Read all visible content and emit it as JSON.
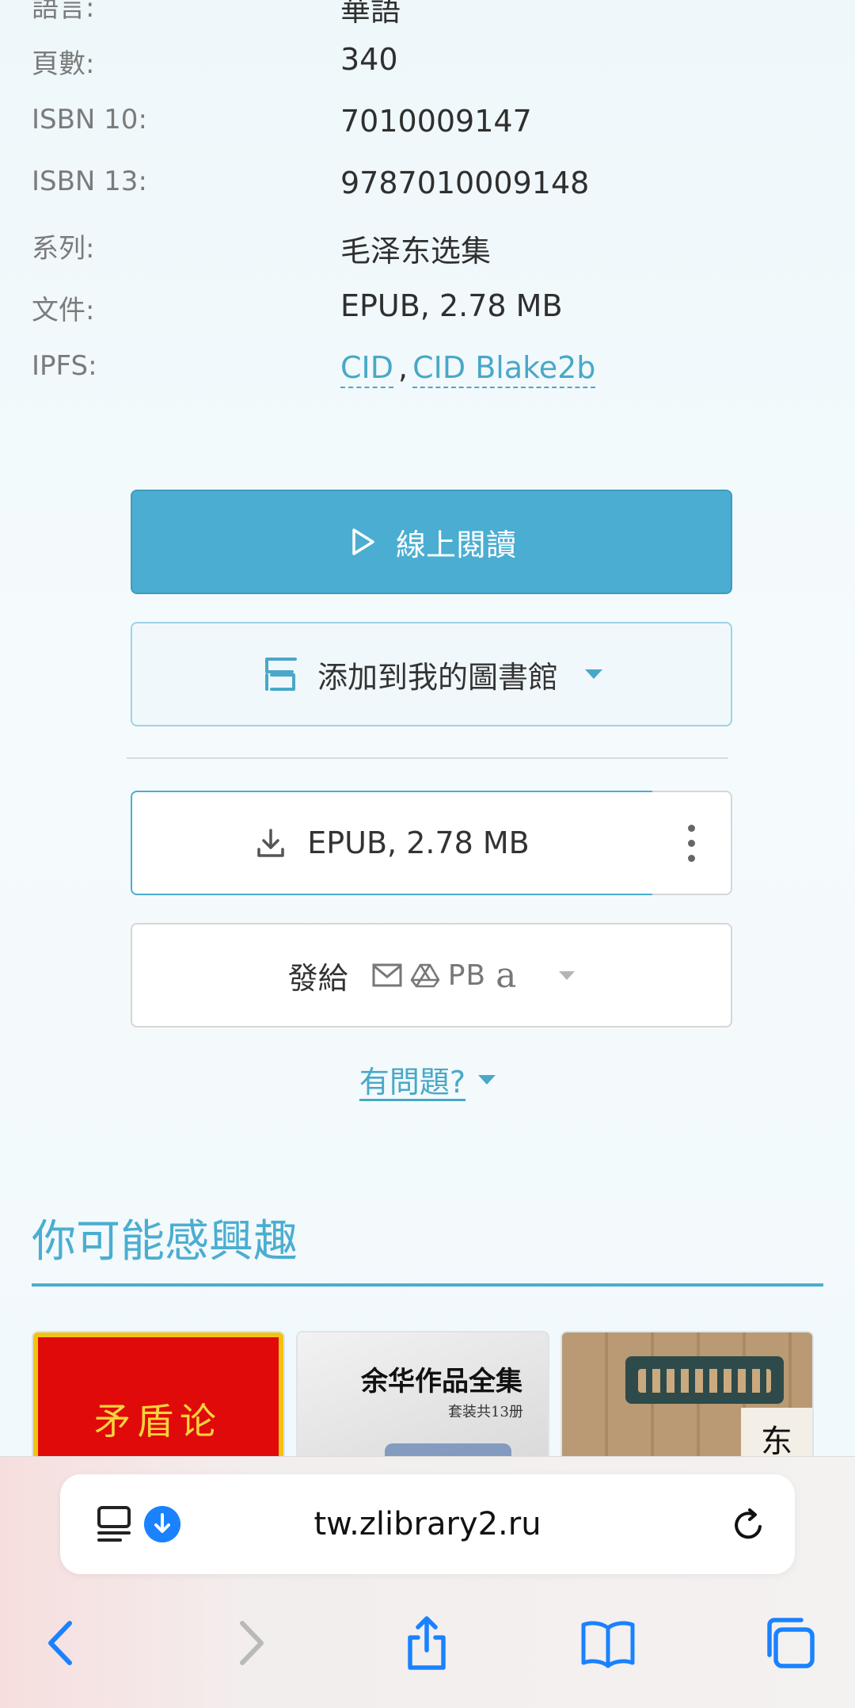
{
  "details": {
    "rows": [
      {
        "label": "語言:",
        "value": "華語",
        "cut": true
      },
      {
        "label": "頁數:",
        "value": "340"
      },
      {
        "label": "ISBN 10:",
        "value": "7010009147"
      },
      {
        "label": "ISBN 13:",
        "value": "9787010009148"
      },
      {
        "label": "系列:",
        "value": "毛泽东选集"
      },
      {
        "label": "文件:",
        "value": "EPUB, 2.78 MB"
      }
    ],
    "ipfs": {
      "label": "IPFS:",
      "link1": "CID",
      "separator": ",",
      "link2": "CID Blake2b"
    }
  },
  "actions": {
    "read_online": "線上閱讀",
    "add_library": "添加到我的圖書館",
    "download": "EPUB, 2.78 MB",
    "send_label": "發給",
    "send_pb": "PB",
    "send_amazon": "a",
    "problem": "有問題?"
  },
  "interest": {
    "title": "你可能感興趣",
    "covers": [
      {
        "title": "矛盾论"
      },
      {
        "title": "余华作品全集",
        "subtitle": "套装共13册"
      },
      {
        "title": "东"
      }
    ]
  },
  "browser": {
    "url": "tw.zlibrary2.ru"
  },
  "colors": {
    "accent": "#4badd1",
    "link": "#49a8c7",
    "ios_blue": "#1a82ff"
  }
}
